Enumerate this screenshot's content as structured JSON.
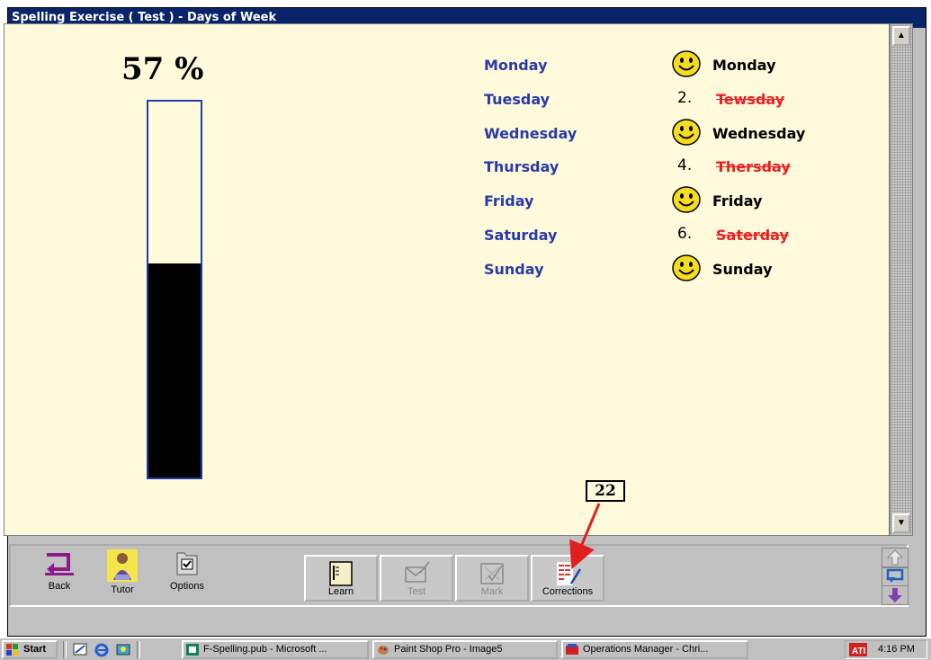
{
  "window": {
    "title": "Spelling Exercise ( Test ) - Days of Week"
  },
  "score": {
    "percent_label": "57 %",
    "fill_fraction": 0.57
  },
  "answers": [
    {
      "question": "Monday",
      "marker": "smiley",
      "response": "Monday",
      "correct": true
    },
    {
      "question": "Tuesday",
      "marker": "2.",
      "response": "Tewsday",
      "correct": false
    },
    {
      "question": "Wednesday",
      "marker": "smiley",
      "response": "Wednesday",
      "correct": true
    },
    {
      "question": "Thursday",
      "marker": "4.",
      "response": "Thersday",
      "correct": false
    },
    {
      "question": "Friday",
      "marker": "smiley",
      "response": "Friday",
      "correct": true
    },
    {
      "question": "Saturday",
      "marker": "6.",
      "response": "Saterday",
      "correct": false
    },
    {
      "question": "Sunday",
      "marker": "smiley",
      "response": "Sunday",
      "correct": true
    }
  ],
  "toolbar": {
    "back_label": "Back",
    "tutor_label": "Tutor",
    "options_label": "Options",
    "learn_label": "Learn",
    "test_label": "Test",
    "mark_label": "Mark",
    "corrections_label": "Corrections"
  },
  "annotation": {
    "label": "22"
  },
  "taskbar": {
    "start_label": "Start",
    "tasks": [
      "F-Spelling.pub - Microsoft ...",
      "Paint Shop Pro - Image5",
      "Operations Manager - Chri..."
    ],
    "clock": "4:16 PM"
  },
  "colors": {
    "title_bar": "#0a246a",
    "content_bg": "#fffadc",
    "question_text": "#2a3aa8",
    "wrong_text": "#e82020",
    "smiley": "#f5dc20"
  },
  "icons": {
    "back": "back-arrow-icon",
    "tutor": "tutor-person-icon",
    "options": "options-checkbox-icon",
    "learn": "learn-book-icon",
    "test": "test-envelope-icon",
    "mark": "mark-check-icon",
    "corrections": "corrections-list-icon",
    "correct_marker": "smiley-icon"
  }
}
